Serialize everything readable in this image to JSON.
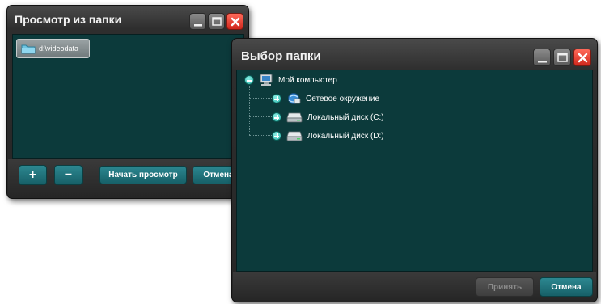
{
  "window_view": {
    "title": "Просмотр из папки",
    "folder_item": {
      "label": "d:\\videodata",
      "icon": "folder-icon"
    },
    "toolbar": {
      "add_label": "+",
      "remove_label": "−",
      "start_label": "Начать просмотр",
      "cancel_label": "Отмена"
    },
    "controls": [
      "minimize-icon",
      "maximize-icon",
      "close-icon"
    ]
  },
  "window_select": {
    "title": "Выбор папки",
    "tree": {
      "root": {
        "label": "Мой компьютер",
        "icon": "computer-icon",
        "expanded": true
      },
      "children": [
        {
          "label": "Сетевое окружение",
          "icon": "network-icon",
          "expanded": false
        },
        {
          "label": "Локальный диск (C:)",
          "icon": "hard-drive-icon",
          "expanded": false
        },
        {
          "label": "Локальный диск (D:)",
          "icon": "hard-drive-icon",
          "expanded": false
        }
      ]
    },
    "toolbar": {
      "accept_label": "Принять",
      "accept_enabled": false,
      "cancel_label": "Отмена"
    },
    "controls": [
      "minimize-icon",
      "maximize-icon",
      "close-icon"
    ]
  },
  "colors": {
    "panel_bg": "#0c3a3b",
    "button_teal": "#1f737b",
    "close_red": "#e43a2c"
  }
}
